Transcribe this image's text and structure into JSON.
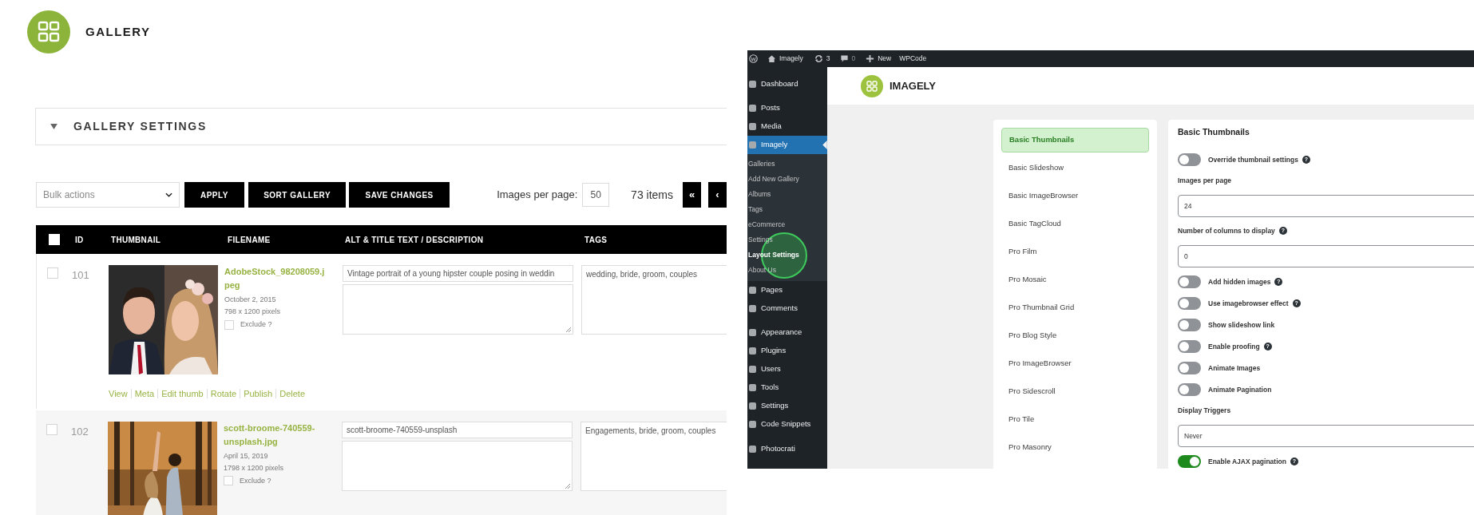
{
  "gallery": {
    "title": "GALLERY",
    "settings_panel": {
      "title": "GALLERY SETTINGS"
    },
    "bulk_actions": {
      "value": "Bulk actions"
    },
    "buttons": [
      "APPLY",
      "SORT GALLERY",
      "SAVE CHANGES"
    ],
    "images_per_page": {
      "label": "Images per page:",
      "value": "50"
    },
    "item_count": "73 items",
    "pagination": [
      "«",
      "‹"
    ],
    "table": {
      "select_all": {
        "checked": false
      },
      "columns": [
        "ID",
        "THUMBNAIL",
        "FILENAME",
        "ALT & TITLE TEXT / DESCRIPTION",
        "TAGS"
      ],
      "rows": [
        {
          "id": "101",
          "selected": false,
          "filename": "AdobeStock_98208059.jpeg",
          "date": "October 2, 2015",
          "dimensions": "798 x 1200 pixels",
          "exclude_label": "Exclude ?",
          "excluded": false,
          "alt_text": "Vintage portrait of a young hipster couple posing in weddin",
          "tags": "wedding, bride, groom, couples",
          "actions": [
            "View",
            "Meta",
            "Edit thumb",
            "Rotate",
            "Publish",
            "Delete"
          ]
        },
        {
          "id": "102",
          "selected": false,
          "filename": "scott-broome-740559-unsplash.jpg",
          "date": "April 15, 2019",
          "dimensions": "1798 x 1200 pixels",
          "exclude_label": "Exclude ?",
          "excluded": false,
          "alt_text": "scott-broome-740559-unsplash",
          "tags": "Engagements, bride, groom, couples"
        }
      ]
    }
  },
  "wp_admin": {
    "top_bar": [
      {
        "kind": "logo"
      },
      {
        "kind": "home",
        "label": "Imagely"
      },
      {
        "kind": "updates",
        "label": "3"
      },
      {
        "kind": "comments",
        "label": "0"
      },
      {
        "kind": "new",
        "label": "New"
      },
      {
        "kind": "text",
        "label": "WPCode"
      }
    ],
    "header": {
      "title": "IMAGELY"
    },
    "sidebar": {
      "groups": [
        [
          {
            "label": "Dashboard",
            "selected": false
          }
        ],
        [
          {
            "label": "Posts",
            "selected": false
          },
          {
            "label": "Media",
            "selected": false
          },
          {
            "label": "Imagely",
            "selected": true,
            "children": [
              {
                "label": "Galleries",
                "selected": false
              },
              {
                "label": "Add New Gallery",
                "selected": false
              },
              {
                "label": "Albums",
                "selected": false
              },
              {
                "label": "Tags",
                "selected": false
              },
              {
                "label": "eCommerce",
                "selected": false
              },
              {
                "label": "Settings",
                "selected": false
              },
              {
                "label": "Layout Settings",
                "selected": true
              },
              {
                "label": "About Us",
                "selected": false
              }
            ]
          },
          {
            "label": "Pages",
            "selected": false
          },
          {
            "label": "Comments",
            "selected": false
          }
        ],
        [
          {
            "label": "Appearance",
            "selected": false
          },
          {
            "label": "Plugins",
            "selected": false
          },
          {
            "label": "Users",
            "selected": false
          },
          {
            "label": "Tools",
            "selected": false
          },
          {
            "label": "Settings",
            "selected": false
          },
          {
            "label": "Code Snippets",
            "selected": false
          }
        ],
        [
          {
            "label": "Photocrati",
            "selected": false
          }
        ]
      ]
    },
    "display_types": [
      {
        "label": "Basic Thumbnails",
        "selected": true
      },
      {
        "label": "Basic Slideshow",
        "selected": false
      },
      {
        "label": "Basic ImageBrowser",
        "selected": false
      },
      {
        "label": "Basic TagCloud",
        "selected": false
      },
      {
        "label": "Pro Film",
        "selected": false
      },
      {
        "label": "Pro Mosaic",
        "selected": false
      },
      {
        "label": "Pro Thumbnail Grid",
        "selected": false
      },
      {
        "label": "Pro Blog Style",
        "selected": false
      },
      {
        "label": "Pro ImageBrowser",
        "selected": false
      },
      {
        "label": "Pro Sidescroll",
        "selected": false
      },
      {
        "label": "Pro Tile",
        "selected": false
      },
      {
        "label": "Pro Masonry",
        "selected": false
      }
    ],
    "settings": {
      "title": "Basic Thumbnails",
      "fields": [
        {
          "kind": "toggle",
          "label": "Override thumbnail settings",
          "on": false,
          "help": "?"
        },
        {
          "kind": "input",
          "label": "Images per page",
          "value": "24"
        },
        {
          "kind": "input",
          "label": "Number of columns to display",
          "help": "?",
          "value": "0"
        },
        {
          "kind": "toggle",
          "label": "Add hidden images",
          "on": false,
          "help": "?"
        },
        {
          "kind": "toggle",
          "label": "Use imagebrowser effect",
          "on": false,
          "help": "?"
        },
        {
          "kind": "toggle",
          "label": "Show slideshow link",
          "on": false
        },
        {
          "kind": "toggle",
          "label": "Enable proofing",
          "on": false,
          "help": "?"
        },
        {
          "kind": "toggle",
          "label": "Animate Images",
          "on": false
        },
        {
          "kind": "toggle",
          "label": "Animate Pagination",
          "on": false
        },
        {
          "kind": "input",
          "label": "Display Triggers",
          "value": "Never"
        },
        {
          "kind": "toggle",
          "label": "Enable AJAX pagination",
          "on": true,
          "help": "?"
        }
      ]
    }
  }
}
